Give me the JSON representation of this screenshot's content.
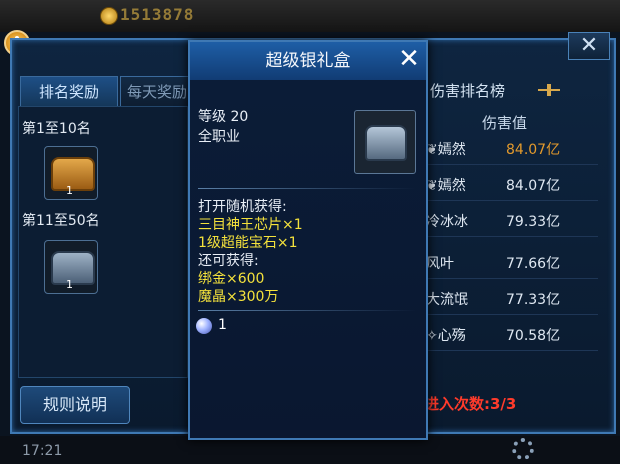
{
  "topbar": {
    "gold_amount": "1513878"
  },
  "main": {
    "tabs": [
      {
        "label": "排名奖励"
      },
      {
        "label": "每天奖励"
      }
    ],
    "close_symbol": "✕",
    "tiers": [
      {
        "label": "第1至10名",
        "chest": "gold-chest",
        "count": "1"
      },
      {
        "label": "第11至50名",
        "chest": "silver-chest",
        "count": "1"
      }
    ],
    "rules_button": "规则说明"
  },
  "ranking": {
    "title": "伤害排名榜",
    "column_header": "伤害值",
    "rows": [
      {
        "name": "❦嫣然",
        "value": "84.07亿",
        "highlight": true
      },
      {
        "name": "❦嫣然",
        "value": "84.07亿"
      },
      {
        "name": "冷冰冰",
        "value": "79.33亿"
      },
      {
        "name": "风叶",
        "value": "77.66亿"
      },
      {
        "name": "大流氓",
        "value": "77.33亿"
      },
      {
        "name": "✧心殇",
        "value": "70.58亿"
      }
    ],
    "entries_text": "进入次数:3/3"
  },
  "status": {
    "time": "17:21"
  },
  "popup": {
    "title": "超级银礼盒",
    "close_symbol": "✕",
    "level_text": "等级 20",
    "class_text": "全职业",
    "random_header": "打开随机获得:",
    "random_items": [
      "三目神王芯片×1",
      "1级超能宝石×1"
    ],
    "extra_header": "还可获得:",
    "extra_items": [
      "绑金×600",
      "魔晶×300万"
    ],
    "gem_count": "1",
    "colors": {
      "highlight_yellow": "#f4e23c",
      "title_blue": "#1e5ea6"
    }
  }
}
